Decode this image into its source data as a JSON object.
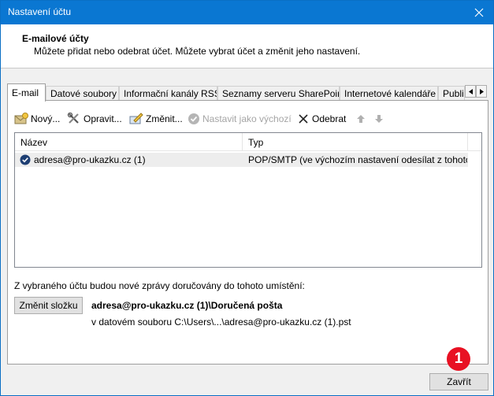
{
  "window": {
    "title": "Nastavení účtu"
  },
  "header": {
    "heading": "E-mailové účty",
    "subheading": "Můžete přidat nebo odebrat účet. Můžete vybrat účet a změnit jeho nastavení."
  },
  "tabs": [
    {
      "label": "E-mail",
      "active": true
    },
    {
      "label": "Datové soubory"
    },
    {
      "label": "Informační kanály RSS"
    },
    {
      "label": "Seznamy serveru SharePoint"
    },
    {
      "label": "Internetové kalendáře"
    },
    {
      "label": "Publi"
    }
  ],
  "toolbar": {
    "new_label": "Nový...",
    "repair_label": "Opravit...",
    "change_label": "Změnit...",
    "set_default_label": "Nastavit jako výchozí",
    "remove_label": "Odebrat"
  },
  "list": {
    "columns": [
      "Název",
      "Typ"
    ],
    "rows": [
      {
        "name": "adresa@pro-ukazku.cz (1)",
        "type": "POP/SMTP (ve výchozím nastavení odesílat z tohoto ..."
      }
    ]
  },
  "delivery": {
    "label": "Z vybraného účtu budou nové zprávy doručovány do tohoto umístění:",
    "change_folder_label": "Změnit složku",
    "target": "adresa@pro-ukazku.cz (1)\\Doručená pošta",
    "path": "v datovém souboru C:\\Users\\...\\adresa@pro-ukazku.cz (1).pst"
  },
  "footer": {
    "close_label": "Zavřít"
  },
  "annotation": {
    "number": "1"
  },
  "colors": {
    "titlebar": "#0a77d2",
    "badge": "#e81123",
    "default_check": "#1e3f73"
  }
}
